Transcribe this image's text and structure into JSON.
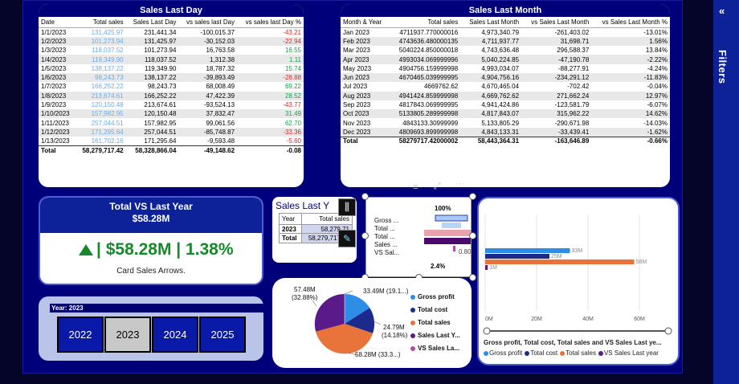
{
  "filters_pane": {
    "label": "Filters",
    "collapse_glyph": "«"
  },
  "sales_last_day": {
    "title": "Sales Last Day",
    "columns": [
      "Date",
      "Total sales",
      "Sales Last Day",
      "vs sales last Day",
      "vs sales last Day %"
    ],
    "rows": [
      [
        "1/1/2023",
        "131,425.97",
        "231,441.34",
        "-100,015.37",
        "-43.21"
      ],
      [
        "1/2/2023",
        "101,273.94",
        "131,425.97",
        "-30,152.03",
        "-22.94"
      ],
      [
        "1/3/2023",
        "118,037.52",
        "101,273.94",
        "16,763.58",
        "16.55"
      ],
      [
        "1/4/2023",
        "119,349.90",
        "118,037.52",
        "1,312.38",
        "1.11"
      ],
      [
        "1/5/2023",
        "138,137.22",
        "119,349.90",
        "18,787.32",
        "15.74"
      ],
      [
        "1/6/2023",
        "98,243.73",
        "138,137.22",
        "-39,893.49",
        "-28.88"
      ],
      [
        "1/7/2023",
        "166,252.22",
        "98,243.73",
        "68,008.49",
        "69.22"
      ],
      [
        "1/8/2023",
        "213,674.61",
        "166,252.22",
        "47,422.39",
        "28.52"
      ],
      [
        "1/9/2023",
        "120,150.48",
        "213,674.61",
        "-93,524.13",
        "-43.77"
      ],
      [
        "1/10/2023",
        "157,982.95",
        "120,150.48",
        "37,832.47",
        "31.49"
      ],
      [
        "1/11/2023",
        "257,044.51",
        "157,982.95",
        "99,061.56",
        "62.70"
      ],
      [
        "1/12/2023",
        "171,295.64",
        "257,044.51",
        "-85,748.87",
        "-33.36"
      ],
      [
        "1/13/2023",
        "161,702.16",
        "171,295.64",
        "-9,593.48",
        "-5.60"
      ]
    ],
    "total": [
      "Total",
      "58,279,717.42",
      "58,328,866.04",
      "-49,148.62",
      "-0.08"
    ]
  },
  "sales_last_month": {
    "title": "Sales Last Month",
    "columns": [
      "Month & Year",
      "Total sales",
      "Sales Last Month",
      "vs Sales Last Month",
      "vs Sales Last Month %"
    ],
    "rows": [
      [
        "Jan 2023",
        "4711937.770000016",
        "4,973,340.79",
        "-261,403.02",
        "-13.01%"
      ],
      [
        "Feb 2023",
        "4743636.480000135",
        "4,711,937.77",
        "31,698.71",
        "1.56%"
      ],
      [
        "Mar 2023",
        "5040224.850000018",
        "4,743,636.48",
        "296,588.37",
        "13.84%"
      ],
      [
        "Apr 2023",
        "4993034.069999996",
        "5,040,224.85",
        "-47,190.78",
        "-2.22%"
      ],
      [
        "May 2023",
        "4904756.159999998",
        "4,993,034.07",
        "-88,277.91",
        "-4.24%"
      ],
      [
        "Jun 2023",
        "4670465.039999995",
        "4,904,756.16",
        "-234,291.12",
        "-11.83%"
      ],
      [
        "Jul 2023",
        "4669762.62",
        "4,670,465.04",
        "-702.42",
        "-0.04%"
      ],
      [
        "Aug 2023",
        "4941424.859999998",
        "4,669,762.62",
        "271,662.24",
        "12.97%"
      ],
      [
        "Sep 2023",
        "4817843.069999995",
        "4,941,424.86",
        "-123,581.79",
        "-6.07%"
      ],
      [
        "Oct 2023",
        "5133805.289999998",
        "4,817,843.07",
        "315,962.22",
        "14.62%"
      ],
      [
        "Nov 2023",
        "4843133.30999999",
        "5,133,805.29",
        "-290,671.98",
        "-14.03%"
      ],
      [
        "Dec 2023",
        "4809693.899999998",
        "4,843,133.31",
        "-33,439.41",
        "-1.62%"
      ]
    ],
    "total": [
      "Total",
      "58279717.42000002",
      "58,443,364.31",
      "-163,646.89",
      "-0.66%"
    ]
  },
  "kpi": {
    "title": "Total VS Last Year",
    "subtitle": "$58.28M",
    "value": "| $58.28M | 1.38%",
    "caption": "Card Sales Arrows."
  },
  "year_slicer": {
    "title": "Year: 2023",
    "years": [
      "2022",
      "2023",
      "2024",
      "2025"
    ],
    "selected": "2023"
  },
  "sales_last_year": {
    "title": "Sales Last Y",
    "columns": [
      "Year",
      "Total sales"
    ],
    "rows": [
      [
        "2023",
        "58,279,71"
      ]
    ],
    "total": [
      "Total",
      "58,279,717.42"
    ]
  },
  "funnel": {
    "top_label": "100%",
    "bottom_label": "2.4%",
    "value_label": "0.80M",
    "categories": [
      "Gross ...",
      "Total ...",
      "Total ...",
      "Sales ...",
      "VS Sal..."
    ],
    "colors": [
      "#a9c9f0",
      "#2e3fb0",
      "#e8778a",
      "#4b0a6b",
      "#b24aa8"
    ]
  },
  "pie": {
    "labels": {
      "top_left": "57.48M",
      "top_left_pct": "(32.88%)",
      "top_right": "33.49M (19.1...)",
      "right": "24.79M",
      "right_pct": "(14.18%)",
      "bottom": "58.28M (33.3...)"
    },
    "legend": [
      "Gross profit",
      "Total cost",
      "Total sales",
      "Sales Last Y...",
      "VS Sales La..."
    ]
  },
  "chart_data": {
    "type": "bar",
    "categories": [
      "Gross profit",
      "Total cost",
      "Total sales",
      "VS Sales Last year"
    ],
    "values": [
      33,
      25,
      58,
      1
    ],
    "data_labels": [
      "33M",
      "25M",
      "58M",
      "1M"
    ],
    "xlim": [
      0,
      60
    ],
    "x_ticks": [
      "0M",
      "20M",
      "40M",
      "60M"
    ],
    "title": "Gross profit, Total cost, Total sales and VS Sales Last ye...",
    "legend": [
      "Gross profit",
      "Total cost",
      "Total sales",
      "VS Sales Last year"
    ],
    "colors": [
      "#2e8ee6",
      "#1b2a8c",
      "#e8743b",
      "#5b1a8a"
    ],
    "legend_position": "bottom"
  },
  "visual_header": {
    "filter_icon": "filter-icon",
    "focus_icon": "focus-mode-icon",
    "more_icon": "more-options-icon"
  }
}
